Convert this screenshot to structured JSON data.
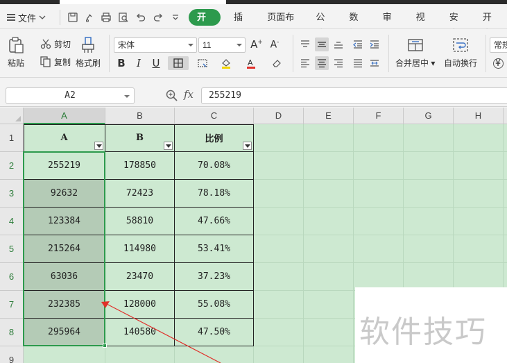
{
  "menubar": {
    "file_label": "文件",
    "tabs": [
      "开始",
      "插入",
      "页面布局",
      "公式",
      "数据",
      "审阅",
      "视图",
      "安全",
      "开发"
    ]
  },
  "ribbon": {
    "paste": "粘贴",
    "cut": "剪切",
    "copy": "复制",
    "format_painter": "格式刷",
    "font_name": "宋体",
    "font_size": "11",
    "merge_center": "合并居中",
    "wrap_text": "自动换行",
    "number_format": "常规"
  },
  "formula": {
    "cell_ref": "A2",
    "fx": "fx",
    "value": "255219"
  },
  "sheet": {
    "columns": [
      "A",
      "B",
      "C",
      "D",
      "E",
      "F",
      "G",
      "H"
    ],
    "rows": [
      "1",
      "2",
      "3",
      "4",
      "5",
      "6",
      "7",
      "8",
      "9"
    ],
    "header": [
      "A",
      "B",
      "比例"
    ],
    "data": [
      [
        "255219",
        "178850",
        "70.08%"
      ],
      [
        "92632",
        "72423",
        "78.18%"
      ],
      [
        "123384",
        "58810",
        "47.66%"
      ],
      [
        "215264",
        "114980",
        "53.41%"
      ],
      [
        "63036",
        "23470",
        "37.23%"
      ],
      [
        "232385",
        "128000",
        "55.08%"
      ],
      [
        "295964",
        "140580",
        "47.50%"
      ]
    ]
  },
  "watermark": "软件技巧",
  "colors": {
    "accent": "#2d9a4d",
    "sheet_bg": "#cde9d1",
    "selection_fill": "#b4cbb6",
    "arrow": "#e0302a"
  }
}
